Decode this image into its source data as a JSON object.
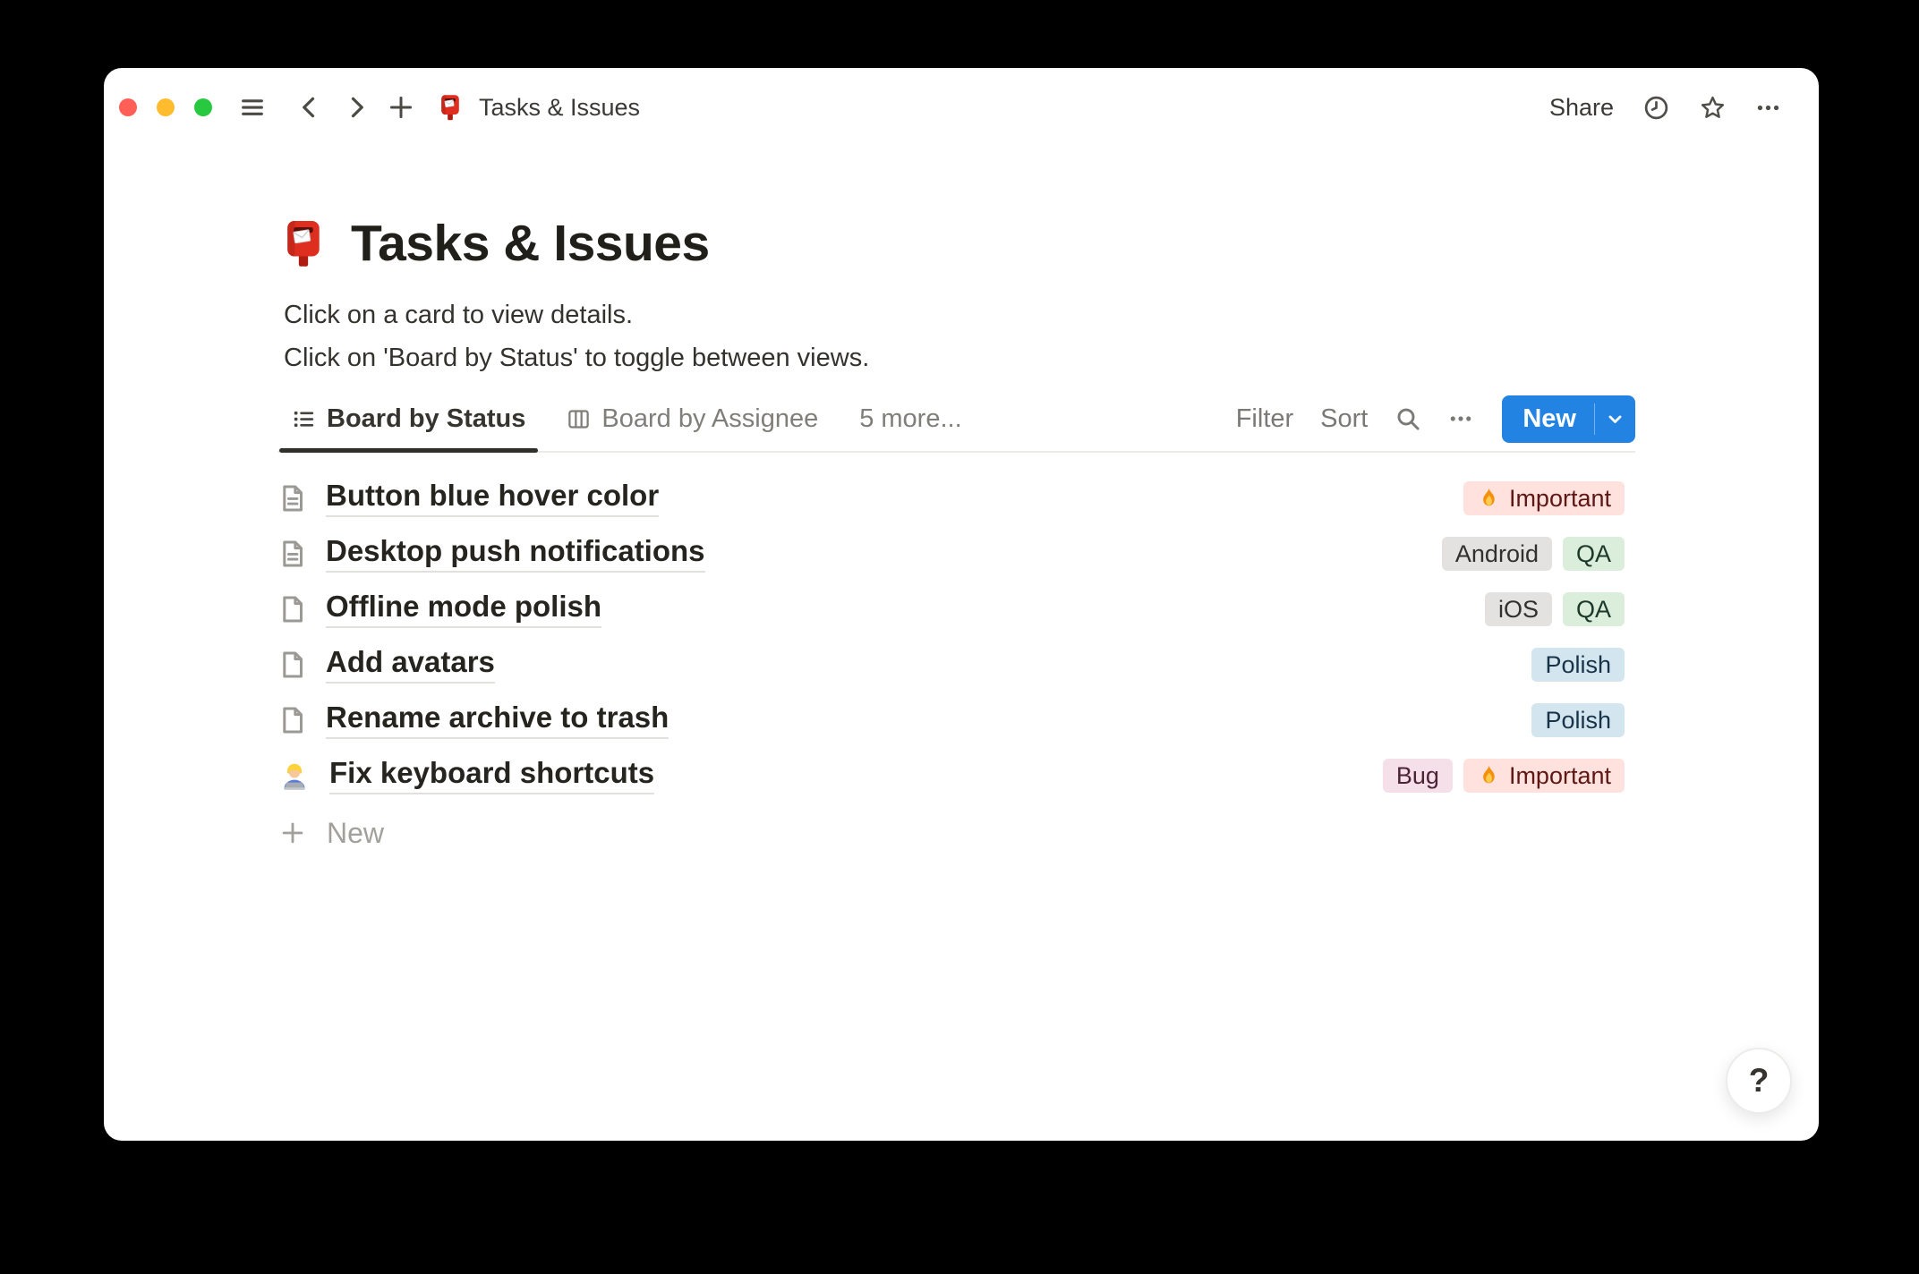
{
  "window": {
    "traffic_lights": [
      {
        "name": "close",
        "color": "#ff5f57"
      },
      {
        "name": "minimize",
        "color": "#febc2e"
      },
      {
        "name": "zoom",
        "color": "#28c840"
      }
    ],
    "topbar": {
      "title": "Tasks & Issues",
      "page_icon": "postbox",
      "share_label": "Share",
      "nav_icons": [
        "menu",
        "back",
        "forward",
        "plus"
      ],
      "action_icons": [
        "clock",
        "star",
        "more"
      ]
    }
  },
  "page": {
    "icon": "postbox",
    "title": "Tasks & Issues",
    "description_lines": [
      "Click on a card to view details.",
      "Click on 'Board by Status' to toggle between views."
    ]
  },
  "toolbar": {
    "tabs": [
      {
        "label": "Board by Status",
        "icon": "list-view",
        "active": true
      },
      {
        "label": "Board by Assignee",
        "icon": "board-view",
        "active": false
      },
      {
        "label": "5 more...",
        "icon": null,
        "active": false
      }
    ],
    "filter_label": "Filter",
    "sort_label": "Sort",
    "search_icon": "search",
    "more_icon": "more",
    "new_button": {
      "label": "New",
      "color": "#2383e2",
      "dropdown_icon": "chevron-down"
    }
  },
  "rows": [
    {
      "icon": "page-text",
      "title": "Button blue hover color",
      "tags": [
        {
          "label": "Important",
          "color": "red",
          "emoji": "fire"
        }
      ]
    },
    {
      "icon": "page-text",
      "title": "Desktop push notifications",
      "tags": [
        {
          "label": "Android",
          "color": "gray"
        },
        {
          "label": "QA",
          "color": "green"
        }
      ]
    },
    {
      "icon": "page-blank",
      "title": "Offline mode polish",
      "tags": [
        {
          "label": "iOS",
          "color": "gray"
        },
        {
          "label": "QA",
          "color": "green"
        }
      ]
    },
    {
      "icon": "page-blank",
      "title": "Add avatars",
      "tags": [
        {
          "label": "Polish",
          "color": "blue"
        }
      ]
    },
    {
      "icon": "page-blank",
      "title": "Rename archive to trash",
      "tags": [
        {
          "label": "Polish",
          "color": "blue"
        }
      ]
    },
    {
      "icon": "technologist",
      "title": "Fix keyboard shortcuts",
      "tags": [
        {
          "label": "Bug",
          "color": "pink"
        },
        {
          "label": "Important",
          "color": "red",
          "emoji": "fire"
        }
      ]
    }
  ],
  "footer": {
    "new_label": "New",
    "icon": "plus"
  },
  "help_button": {
    "label": "?"
  },
  "colors": {
    "accent_blue": "#2383e2",
    "tag_palette": {
      "gray": {
        "bg": "#e3e2e0",
        "text": "#32302c"
      },
      "green": {
        "bg": "#dbeddb",
        "text": "#1c3829"
      },
      "blue": {
        "bg": "#d3e5ef",
        "text": "#183347"
      },
      "red": {
        "bg": "#ffe2dd",
        "text": "#5d1715"
      },
      "pink": {
        "bg": "#f5e0e9",
        "text": "#4c2337"
      }
    }
  }
}
